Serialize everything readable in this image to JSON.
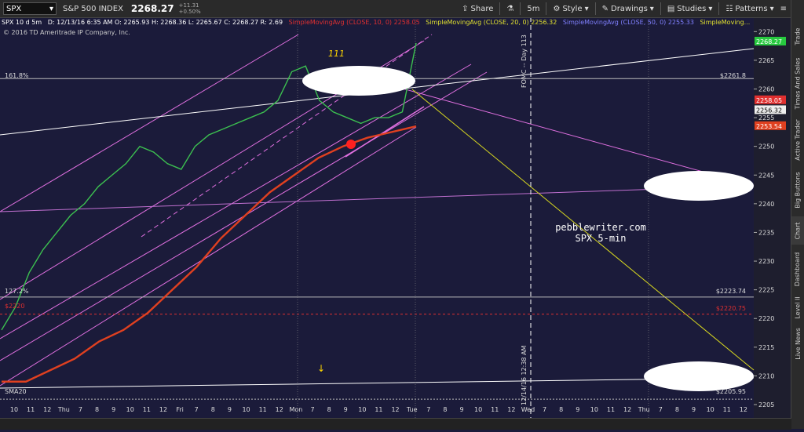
{
  "toolbar": {
    "symbol": "SPX",
    "symbol_name": "S&P 500 INDEX",
    "last": "2268.27",
    "change": "+11.31",
    "change_pct": "+0.50%",
    "share": "Share",
    "interval": "5m",
    "style": "Style",
    "drawings": "Drawings",
    "studies": "Studies",
    "patterns": "Patterns"
  },
  "legend": {
    "title": "SPX 10 d 5m",
    "ohlc": "D: 12/13/16 6:35 AM  O: 2265.93  H: 2268.36  L: 2265.67  C: 2268.27  R: 2.69",
    "sma10": "SimpleMovingAvg (CLOSE, 10, 0)  2258.05",
    "sma20": "SimpleMovingAvg (CLOSE, 20, 0)  2256.32",
    "sma50": "SimpleMovingAvg (CLOSE, 50, 0)  2255.33",
    "sma_more": "SimpleMoving..."
  },
  "copyright": "© 2016 TD Ameritrade IP Company, Inc.",
  "sidebar": [
    "Trade",
    "Times And Sales",
    "Active Trader",
    "Big Buttons",
    "Chart",
    "Dashboard",
    "Level II",
    "Live News"
  ],
  "colors": {
    "bg": "#1b1b3a",
    "sma10": "#e03030",
    "sma20": "#e0e030",
    "sma50": "#8080ff",
    "sma200": "#e04020",
    "channel": "#e070e0",
    "forecast": "#d8d820"
  },
  "annotations": {
    "fib161": "161.8%",
    "fib127": "127.2%",
    "sma20": "SMA20",
    "label_111": "111",
    "fomc": "FOMC -- Day 113",
    "time_marker": "12/14/16 12:38 AM",
    "watermark1": "pebblewriter.com",
    "watermark2": "SPX 5-min",
    "lvl_2261": "$2261.8",
    "lvl_2223": "$2223.74",
    "lvl_2220": "$2220.75",
    "lvl_2205": "$2205.95",
    "lvl_red_left": "$2220"
  },
  "chart_data": {
    "type": "line",
    "ylim": [
      2203.5,
      2272.5
    ],
    "y_ticks": [
      2205,
      2210,
      2215,
      2220,
      2225,
      2230,
      2235,
      2240,
      2245,
      2250,
      2255,
      2260,
      2265,
      2270
    ],
    "x_tick_labels": [
      "10",
      "11",
      "12",
      "Thu",
      "7",
      "8",
      "9",
      "10",
      "11",
      "12",
      "Fri",
      "7",
      "8",
      "9",
      "10",
      "11",
      "12",
      "Mon",
      "7",
      "8",
      "9",
      "10",
      "11",
      "12",
      "Tue",
      "7",
      "8",
      "9",
      "10",
      "11",
      "12",
      "Wed",
      "7",
      "8",
      "9",
      "10",
      "11",
      "12",
      "Thu",
      "7",
      "8",
      "9",
      "10",
      "11",
      "12"
    ],
    "price_badges": [
      {
        "value": 2268.27,
        "text": "2268.27",
        "color": "#27c93f"
      },
      {
        "value": 2258.05,
        "text": "2258.05",
        "color": "#e03030"
      },
      {
        "value": 2256.32,
        "text": "2256.32",
        "color": "#eeeeee"
      },
      {
        "value": 2253.54,
        "text": "2253.54",
        "color": "#e04020"
      }
    ],
    "series": [
      {
        "name": "SPX",
        "values": [
          2218,
          2222,
          2228,
          2232,
          2235,
          2238,
          2240,
          2243,
          2245,
          2247,
          2250,
          2249,
          2247,
          2246,
          2250,
          2252,
          2253,
          2254,
          2255,
          2256,
          2258,
          2263,
          2264,
          2258,
          2256,
          2255,
          2254,
          2255,
          2255,
          2256,
          2268
        ]
      },
      {
        "name": "SMA200",
        "values": [
          2209,
          2209,
          2211,
          2213,
          2216,
          2218,
          2221,
          2225,
          2229,
          2234,
          2238,
          2242,
          2245,
          2248,
          2250,
          2251.5,
          2252.5,
          2253.5
        ]
      }
    ],
    "reference_levels": [
      2261.8,
      2223.74,
      2220.75,
      2205.95
    ]
  }
}
